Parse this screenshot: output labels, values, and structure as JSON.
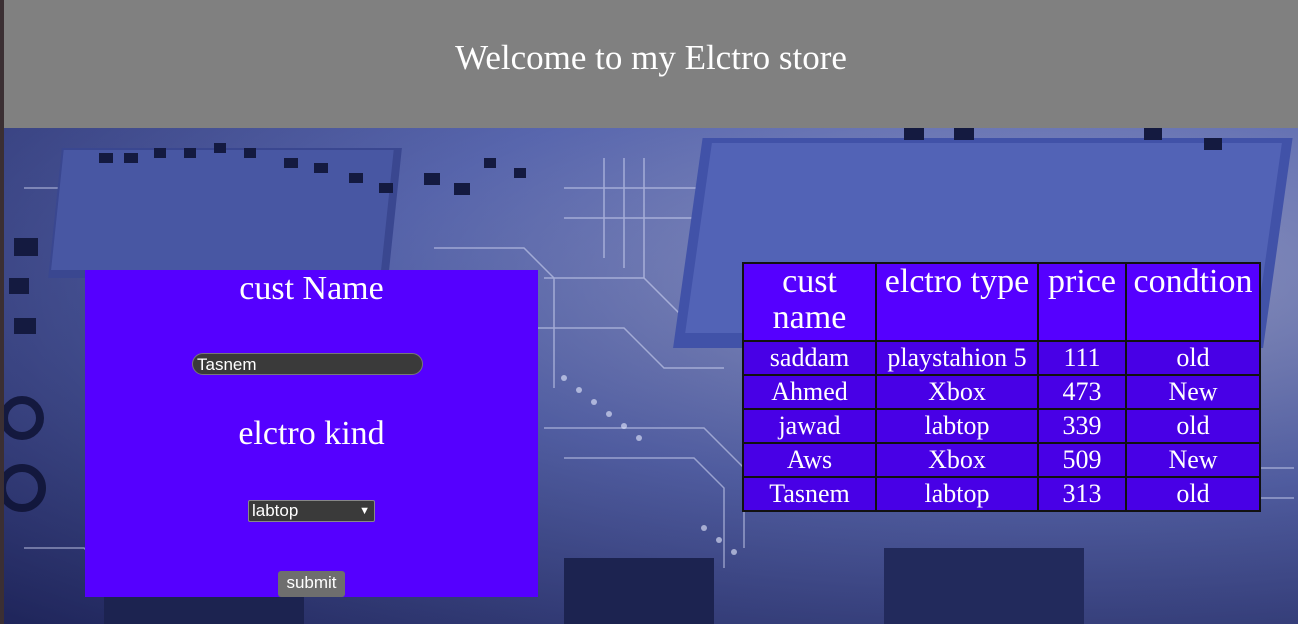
{
  "header": {
    "title": "Welcome to my Elctro store"
  },
  "form": {
    "name_label": "cust Name",
    "name_value": "Tasnem",
    "kind_label": "elctro kind",
    "kind_selected": "labtop",
    "submit_label": "submit"
  },
  "table": {
    "headers": [
      "cust name",
      "elctro type",
      "price",
      "condtion"
    ],
    "rows": [
      [
        "saddam",
        "playstahion 5",
        "111",
        "old"
      ],
      [
        "Ahmed",
        "Xbox",
        "473",
        "New"
      ],
      [
        "jawad",
        "labtop",
        "339",
        "old"
      ],
      [
        "Aws",
        "Xbox",
        "509",
        "New"
      ],
      [
        "Tasnem",
        "labtop",
        "313",
        "old"
      ]
    ]
  }
}
